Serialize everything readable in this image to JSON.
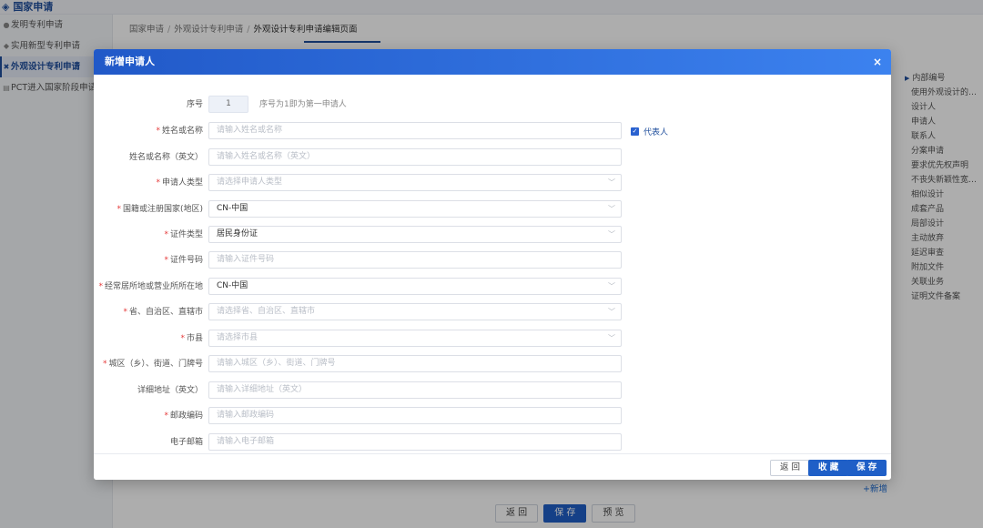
{
  "app": {
    "title": "国家申请"
  },
  "sidebar": {
    "items": [
      {
        "label": "发明专利申请"
      },
      {
        "label": "实用新型专利申请"
      },
      {
        "label": "外观设计专利申请"
      },
      {
        "label": "PCT进入国家阶段申请"
      }
    ]
  },
  "breadcrumb": {
    "items": [
      "国家申请",
      "外观设计专利申请",
      "外观设计专利申请编辑页面"
    ]
  },
  "right_nav": {
    "items": [
      "内部编号",
      "使用外观设计的产品名称",
      "设计人",
      "申请人",
      "联系人",
      "分案申请",
      "要求优先权声明",
      "不丧失新颖性宽限期",
      "相似设计",
      "成套产品",
      "局部设计",
      "主动放弃",
      "延迟审查",
      "附加文件",
      "关联业务",
      "证明文件备案"
    ]
  },
  "add_link": "+新增",
  "bottom_bar": {
    "back": "返 回",
    "save": "保 存",
    "preview": "预 览"
  },
  "modal": {
    "title": "新增申请人",
    "close": "×",
    "seq": {
      "label": "序号",
      "value": "1",
      "hint": "序号为1即为第一申请人"
    },
    "representative": {
      "label": "代表人",
      "checked": true
    },
    "fields": [
      {
        "label": "姓名或名称",
        "required": true,
        "type": "input",
        "placeholder": "请输入姓名或名称",
        "value": ""
      },
      {
        "label": "姓名或名称（英文）",
        "required": false,
        "type": "input",
        "placeholder": "请输入姓名或名称（英文）",
        "value": ""
      },
      {
        "label": "申请人类型",
        "required": true,
        "type": "select",
        "placeholder": "请选择申请人类型",
        "value": ""
      },
      {
        "label": "国籍或注册国家(地区)",
        "required": true,
        "type": "select",
        "placeholder": "",
        "value": "CN-中国"
      },
      {
        "label": "证件类型",
        "required": true,
        "type": "select",
        "placeholder": "",
        "value": "居民身份证"
      },
      {
        "label": "证件号码",
        "required": true,
        "type": "input",
        "placeholder": "请输入证件号码",
        "value": ""
      },
      {
        "label": "经常居所地或营业所所在地",
        "required": true,
        "type": "select",
        "placeholder": "",
        "value": "CN-中国"
      },
      {
        "label": "省、自治区、直辖市",
        "required": true,
        "type": "select",
        "placeholder": "请选择省、自治区、直辖市",
        "value": ""
      },
      {
        "label": "市县",
        "required": true,
        "type": "select",
        "placeholder": "请选择市县",
        "value": ""
      },
      {
        "label": "城区（乡）、街道、门牌号",
        "required": true,
        "type": "input",
        "placeholder": "请输入城区（乡）、街道、门牌号",
        "value": ""
      },
      {
        "label": "详细地址（英文）",
        "required": false,
        "type": "input",
        "placeholder": "请输入详细地址（英文）",
        "value": ""
      },
      {
        "label": "邮政编码",
        "required": true,
        "type": "input",
        "placeholder": "请输入邮政编码",
        "value": ""
      },
      {
        "label": "电子邮箱",
        "required": false,
        "type": "input",
        "placeholder": "请输入电子邮箱",
        "value": ""
      }
    ],
    "footer": {
      "back": "返 回",
      "collect": "收 藏",
      "save": "保 存"
    }
  }
}
